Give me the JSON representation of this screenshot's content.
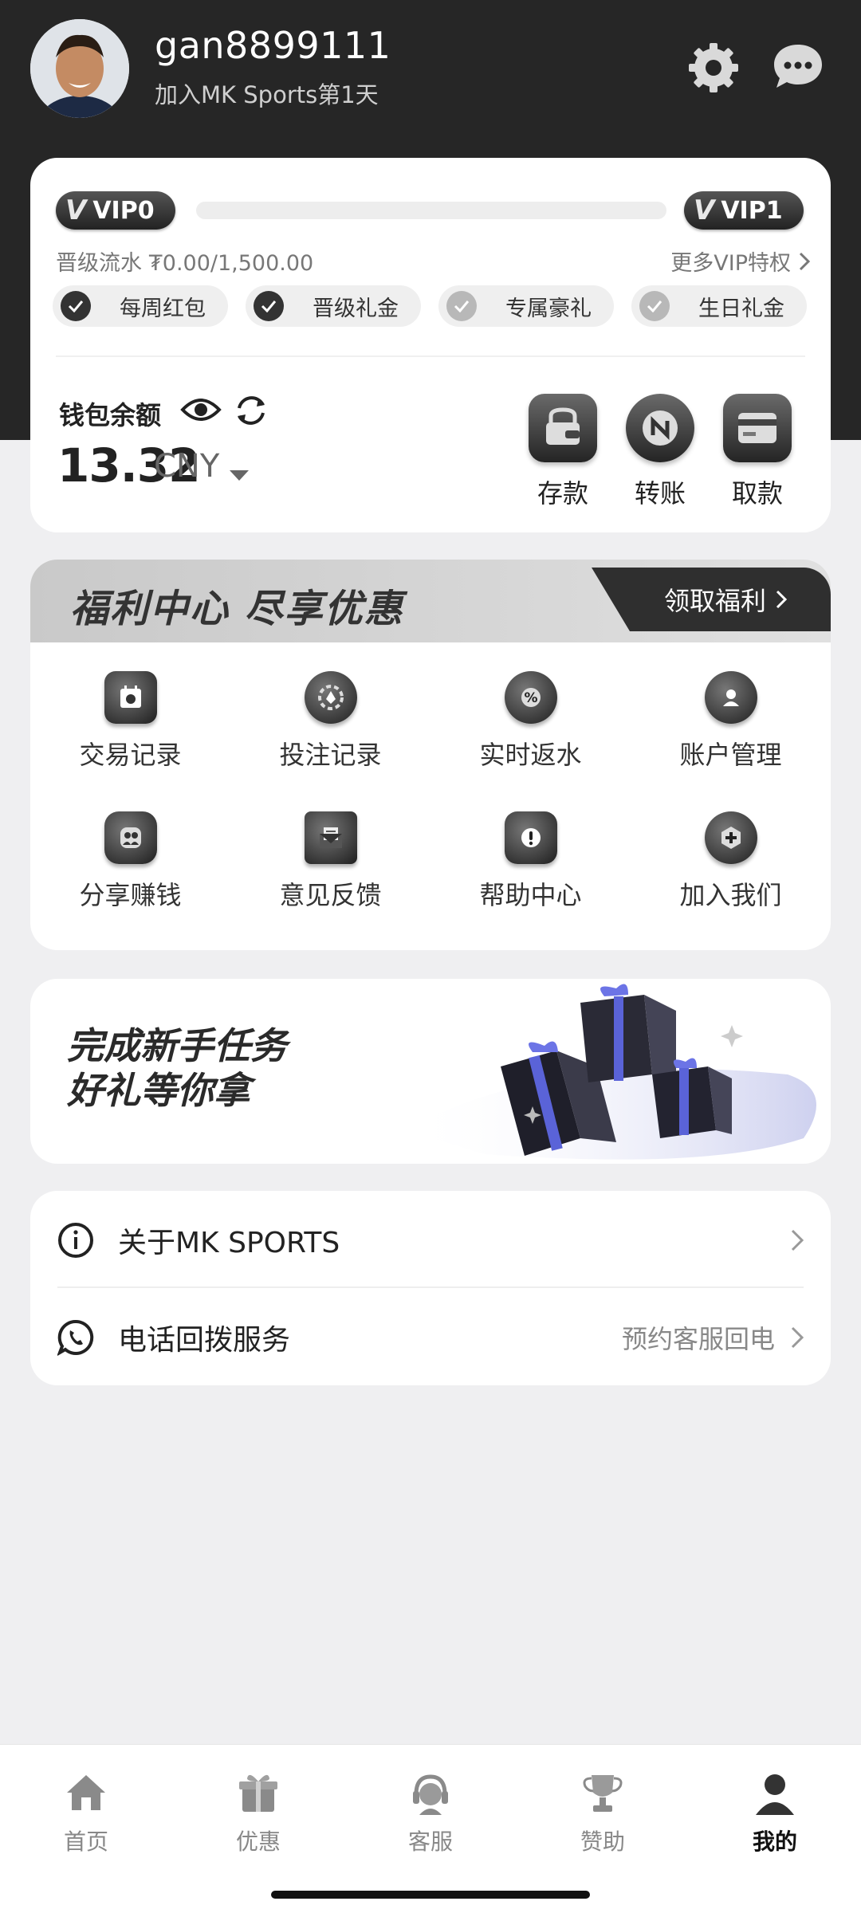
{
  "profile": {
    "username": "gan8899111",
    "joined": "加入MK Sports第1天",
    "avatar": "avatar-photo"
  },
  "header_icons": [
    "gear-icon",
    "chat-icon"
  ],
  "vip": {
    "current": "VIP0",
    "next": "VIP1",
    "flow_text": "晋级流水 ₮0.00/1,500.00",
    "progress": 0,
    "more_link": "更多VIP特权",
    "perks": [
      {
        "label": "每周红包",
        "active": true
      },
      {
        "label": "晋级礼金",
        "active": true
      },
      {
        "label": "专属豪礼",
        "active": false
      },
      {
        "label": "生日礼金",
        "active": false
      }
    ]
  },
  "wallet": {
    "label": "钱包余额",
    "balance": "13.32",
    "currency": "CNY",
    "actions": [
      "存款",
      "转账",
      "取款"
    ]
  },
  "benefits": {
    "title": "福利中心 尽享优惠",
    "claim": "领取福利",
    "items": [
      "交易记录",
      "投注记录",
      "实时返水",
      "账户管理",
      "分享赚钱",
      "意见反馈",
      "帮助中心",
      "加入我们"
    ]
  },
  "banner": {
    "line1": "完成新手任务",
    "line2": "好礼等你拿"
  },
  "list": {
    "about": "关于MK SPORTS",
    "callback": "电话回拨服务",
    "callback_sub": "预约客服回电"
  },
  "tabs": [
    "首页",
    "优惠",
    "客服",
    "赞助",
    "我的"
  ],
  "colors": {
    "dark": "#262626",
    "bg": "#efeff1",
    "accent": "#2f2f2f"
  }
}
